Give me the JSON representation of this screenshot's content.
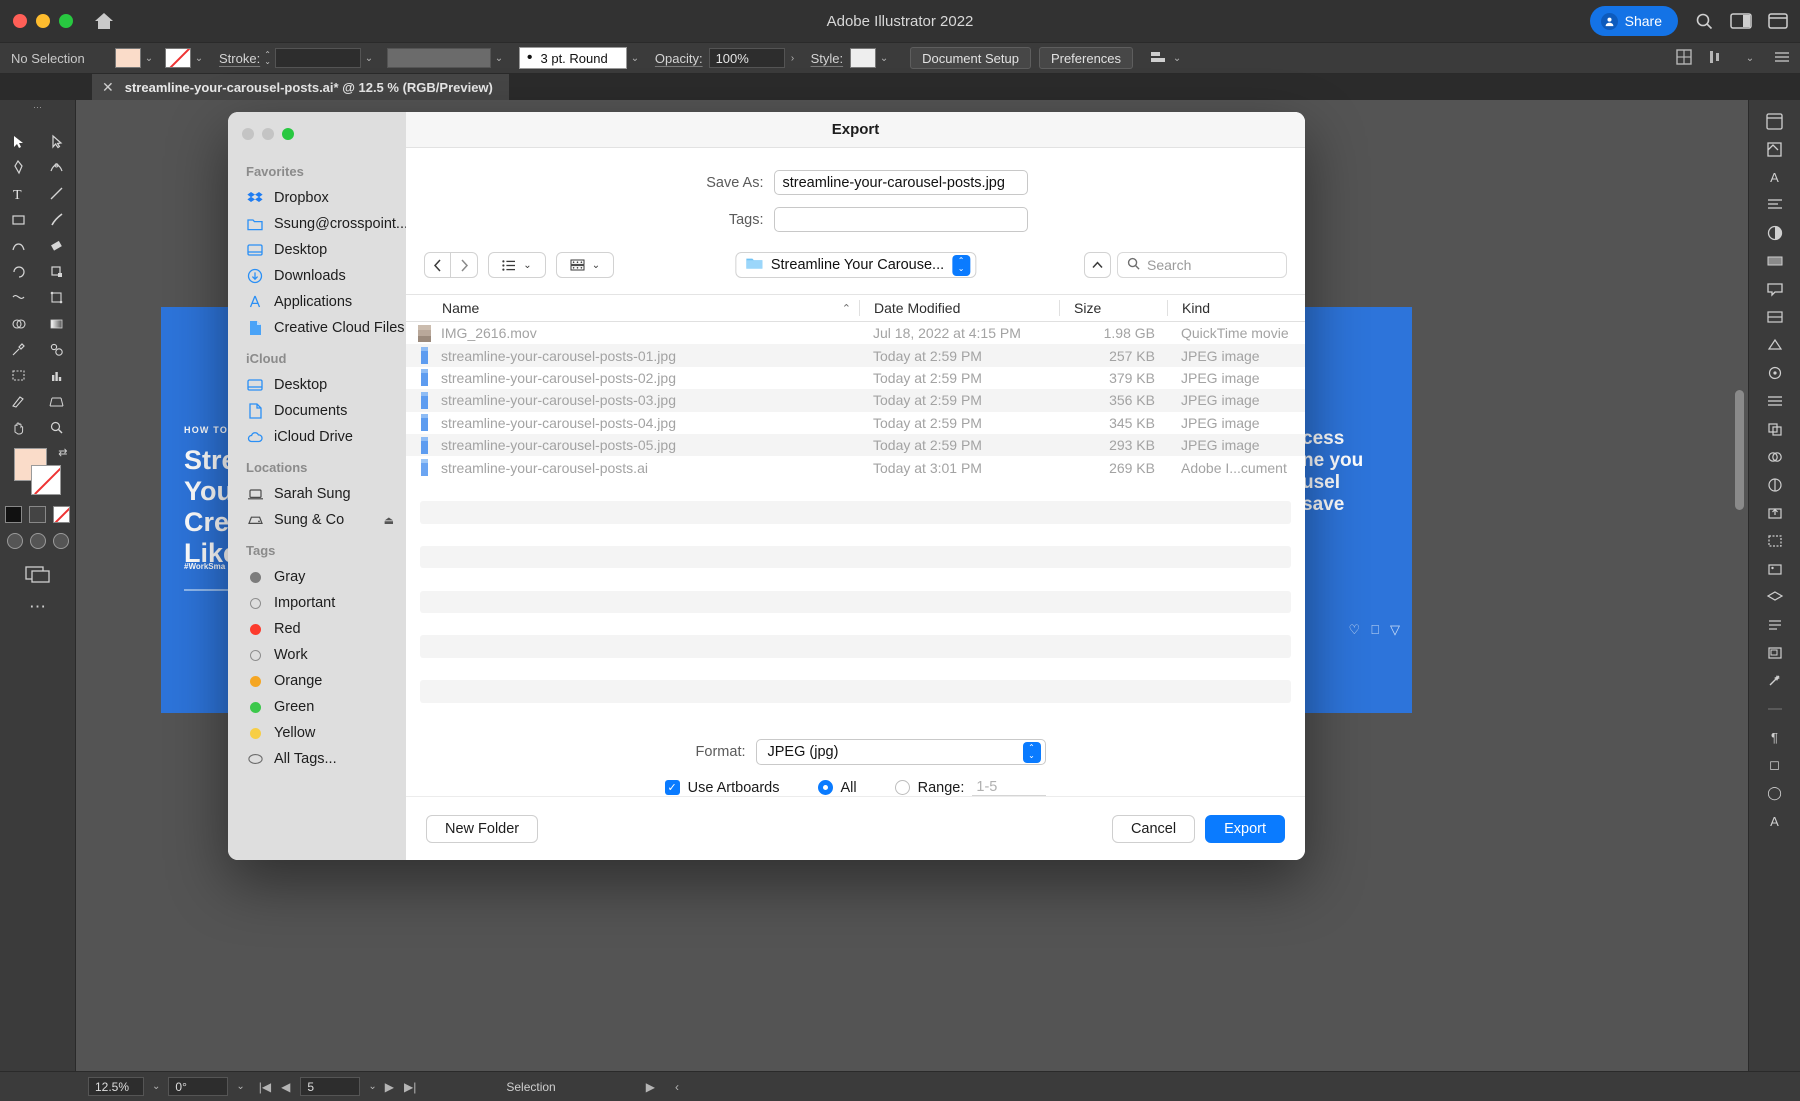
{
  "app": {
    "title": "Adobe Illustrator 2022",
    "share_label": "Share",
    "document_tab": "streamline-your-carousel-posts.ai* @ 12.5 % (RGB/Preview)"
  },
  "control_bar": {
    "selection_status": "No Selection",
    "stroke_label": "Stroke:",
    "brush_value": "3 pt. Round",
    "opacity_label": "Opacity:",
    "opacity_value": "100%",
    "style_label": "Style:",
    "document_setup": "Document Setup",
    "preferences": "Preferences"
  },
  "status_bar": {
    "zoom": "12.5%",
    "rotation": "0°",
    "artboard": "5",
    "tool": "Selection"
  },
  "canvas": {
    "left_artboard": {
      "eyebrow": "HOW TO",
      "line1": "Stre",
      "line2": "Your",
      "line3": "Crea",
      "line4": "Like",
      "hashtag": "#WorkSma"
    },
    "right_artboard": {
      "line1": "cess",
      "line2": "ne you",
      "line3": "usel",
      "line4": "save"
    }
  },
  "dialog": {
    "title": "Export",
    "save_as_label": "Save As:",
    "save_as_value": "streamline-your-carousel-posts.jpg",
    "tags_label": "Tags:",
    "tags_value": "",
    "path_popup": "Streamline Your Carouse...",
    "search_placeholder": "Search",
    "columns": {
      "name": "Name",
      "date_modified": "Date Modified",
      "size": "Size",
      "kind": "Kind"
    },
    "files": [
      {
        "name": "IMG_2616.mov",
        "date": "Jul 18, 2022 at 4:15 PM",
        "size": "1.98 GB",
        "kind": "QuickTime movie",
        "icon": "movie-thumb-icon"
      },
      {
        "name": "streamline-your-carousel-posts-01.jpg",
        "date": "Today at 2:59 PM",
        "size": "257 KB",
        "kind": "JPEG image",
        "icon": "jpeg-file-icon"
      },
      {
        "name": "streamline-your-carousel-posts-02.jpg",
        "date": "Today at 2:59 PM",
        "size": "379 KB",
        "kind": "JPEG image",
        "icon": "jpeg-file-icon"
      },
      {
        "name": "streamline-your-carousel-posts-03.jpg",
        "date": "Today at 2:59 PM",
        "size": "356 KB",
        "kind": "JPEG image",
        "icon": "jpeg-file-icon"
      },
      {
        "name": "streamline-your-carousel-posts-04.jpg",
        "date": "Today at 2:59 PM",
        "size": "345 KB",
        "kind": "JPEG image",
        "icon": "jpeg-file-icon"
      },
      {
        "name": "streamline-your-carousel-posts-05.jpg",
        "date": "Today at 2:59 PM",
        "size": "293 KB",
        "kind": "JPEG image",
        "icon": "jpeg-file-icon"
      },
      {
        "name": "streamline-your-carousel-posts.ai",
        "date": "Today at 3:01 PM",
        "size": "269 KB",
        "kind": "Adobe I...cument",
        "icon": "ai-file-icon"
      }
    ],
    "format_label": "Format:",
    "format_value": "JPEG (jpg)",
    "use_artboards_label": "Use Artboards",
    "all_label": "All",
    "range_label": "Range:",
    "range_placeholder": "1-5",
    "new_folder": "New Folder",
    "cancel": "Cancel",
    "export": "Export",
    "sidebar": {
      "favorites_header": "Favorites",
      "favorites": [
        {
          "label": "Dropbox",
          "icon": "dropbox-icon"
        },
        {
          "label": "Ssung@crosspoint...",
          "icon": "folder-icon"
        },
        {
          "label": "Desktop",
          "icon": "desktop-icon"
        },
        {
          "label": "Downloads",
          "icon": "downloads-icon"
        },
        {
          "label": "Applications",
          "icon": "applications-icon"
        },
        {
          "label": "Creative Cloud Files",
          "icon": "document-icon"
        }
      ],
      "icloud_header": "iCloud",
      "icloud": [
        {
          "label": "Desktop",
          "icon": "desktop-icon"
        },
        {
          "label": "Documents",
          "icon": "document-icon"
        },
        {
          "label": "iCloud Drive",
          "icon": "cloud-icon"
        }
      ],
      "locations_header": "Locations",
      "locations": [
        {
          "label": "Sarah Sung",
          "icon": "laptop-icon",
          "eject": false
        },
        {
          "label": "Sung & Co",
          "icon": "drive-icon",
          "eject": true
        }
      ],
      "tags_header": "Tags",
      "tags": [
        {
          "label": "Gray",
          "color": "#7c7c7c"
        },
        {
          "label": "Important",
          "color": ""
        },
        {
          "label": "Red",
          "color": "#fc3b2d"
        },
        {
          "label": "Work",
          "color": ""
        },
        {
          "label": "Orange",
          "color": "#f5a623"
        },
        {
          "label": "Green",
          "color": "#3cc84b"
        },
        {
          "label": "Yellow",
          "color": "#f7ce46"
        },
        {
          "label": "All Tags...",
          "color": ""
        }
      ]
    }
  },
  "colors": {
    "accent_blue": "#0a7bff",
    "illustrator_blue": "#1473e6",
    "artboard_blue": "#2d74da",
    "chrome_dark": "#323232"
  }
}
